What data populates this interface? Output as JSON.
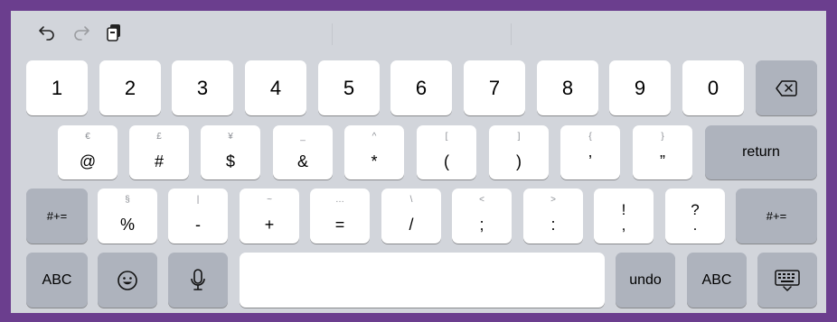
{
  "toolbar": {
    "icons": [
      "undo-arrow-icon",
      "redo-arrow-icon",
      "paste-icon"
    ]
  },
  "row1": {
    "keys": [
      "1",
      "2",
      "3",
      "4",
      "5",
      "6",
      "7",
      "8",
      "9",
      "0"
    ],
    "delete_icon": "delete-icon"
  },
  "row2": {
    "keys": [
      {
        "alt": "€",
        "main": "@"
      },
      {
        "alt": "£",
        "main": "#"
      },
      {
        "alt": "¥",
        "main": "$"
      },
      {
        "alt": "_",
        "main": "&"
      },
      {
        "alt": "^",
        "main": "*"
      },
      {
        "alt": "[",
        "main": "("
      },
      {
        "alt": "]",
        "main": ")"
      },
      {
        "alt": "{",
        "main": "’"
      },
      {
        "alt": "}",
        "main": "”"
      }
    ],
    "return_label": "return"
  },
  "row3": {
    "left_label": "#+=",
    "right_label": "#+=",
    "keys": [
      {
        "alt": "§",
        "main": "%"
      },
      {
        "alt": "|",
        "main": "-"
      },
      {
        "alt": "~",
        "main": "+"
      },
      {
        "alt": "…",
        "main": "="
      },
      {
        "alt": "\\",
        "main": "/"
      },
      {
        "alt": "<",
        "main": ";"
      },
      {
        "alt": ">",
        "main": ":"
      }
    ],
    "exclaim": {
      "top": "!",
      "bottom": ","
    },
    "question": {
      "top": "?",
      "bottom": "."
    }
  },
  "row4": {
    "abc_left": "ABC",
    "emoji_icon": "emoji-icon",
    "mic_icon": "microphone-icon",
    "undo_label": "undo",
    "abc_right": "ABC",
    "hide_keyboard_icon": "keyboard-hide-icon"
  }
}
